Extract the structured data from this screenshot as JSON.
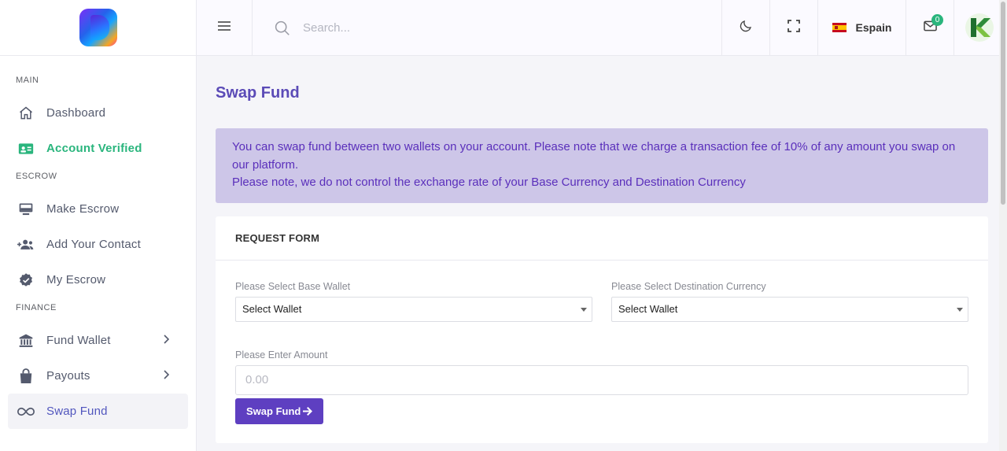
{
  "sidebar": {
    "sections": [
      {
        "title": "MAIN"
      },
      {
        "title": "ESCROW"
      },
      {
        "title": "FINANCE"
      }
    ],
    "items": [
      {
        "label": "Dashboard",
        "icon": "home-icon"
      },
      {
        "label": "Account Verified",
        "icon": "id-card-icon"
      },
      {
        "label": "Make Escrow",
        "icon": "monitor-icon"
      },
      {
        "label": "Add Your Contact",
        "icon": "users-plus-icon"
      },
      {
        "label": "My Escrow",
        "icon": "badge-check-icon"
      },
      {
        "label": "Fund Wallet",
        "icon": "bank-icon"
      },
      {
        "label": "Payouts",
        "icon": "shopping-bag-icon"
      },
      {
        "label": "Swap Fund",
        "icon": "infinity-icon"
      }
    ]
  },
  "topbar": {
    "search_placeholder": "Search...",
    "language": "Espain",
    "mail_count": "0"
  },
  "main": {
    "title": "Swap Fund",
    "alert_line1": "You can swap fund between two wallets on your account. Please note that we charge a transaction fee of 10% of any amount you swap on our platform.",
    "alert_line2": "Please note, we do not control the exchange rate of your Base Currency and Destination Currency",
    "form": {
      "header": "REQUEST FORM",
      "base_label": "Please Select Base Wallet",
      "base_value": "Select Wallet",
      "dest_label": "Please Select Destination Currency",
      "dest_value": "Select Wallet",
      "amount_label": "Please Enter Amount",
      "amount_placeholder": "0.00",
      "submit_label": "Swap Fund"
    }
  },
  "colors": {
    "accent": "#5b4bb7",
    "success": "#2ab57d",
    "alert_bg": "#cdc6e8",
    "button": "#5e3fc1"
  }
}
